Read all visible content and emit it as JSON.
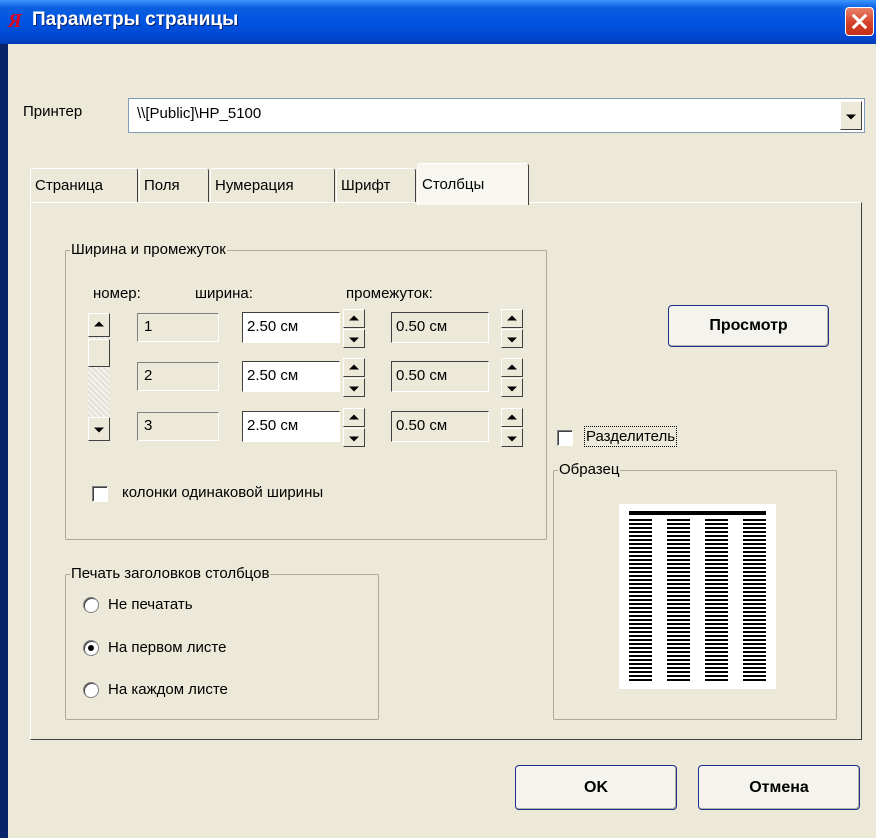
{
  "title": "Параметры страницы",
  "printer": {
    "label": "Принтер",
    "value": "\\\\[Public]\\HP_5100"
  },
  "tabs": [
    "Страница",
    "Поля",
    "Нумерация",
    "Шрифт",
    "Столбцы"
  ],
  "width_group": {
    "title": "Ширина и промежуток",
    "col_number": "номер:",
    "col_width": "ширина:",
    "col_gap": "промежуток:",
    "rows": [
      {
        "num": "1",
        "width": "2.50 см",
        "gap": "0.50 см"
      },
      {
        "num": "2",
        "width": "2.50 см",
        "gap": "0.50 см"
      },
      {
        "num": "3",
        "width": "2.50 см",
        "gap": "0.50 см"
      }
    ],
    "equal_width_label": "колонки одинаковой ширины"
  },
  "print_group": {
    "title": "Печать заголовков столбцов",
    "options": [
      "Не печатать",
      "На первом листе",
      "На каждом листе"
    ],
    "selected": "На первом листе"
  },
  "preview_button": "Просмотр",
  "separator_label": "Разделитель",
  "sample_group": {
    "title": "Образец"
  },
  "ok_button": "OK",
  "cancel_button": "Отмена",
  "icons": {
    "app": "app-logo-icon",
    "close": "close-icon"
  }
}
